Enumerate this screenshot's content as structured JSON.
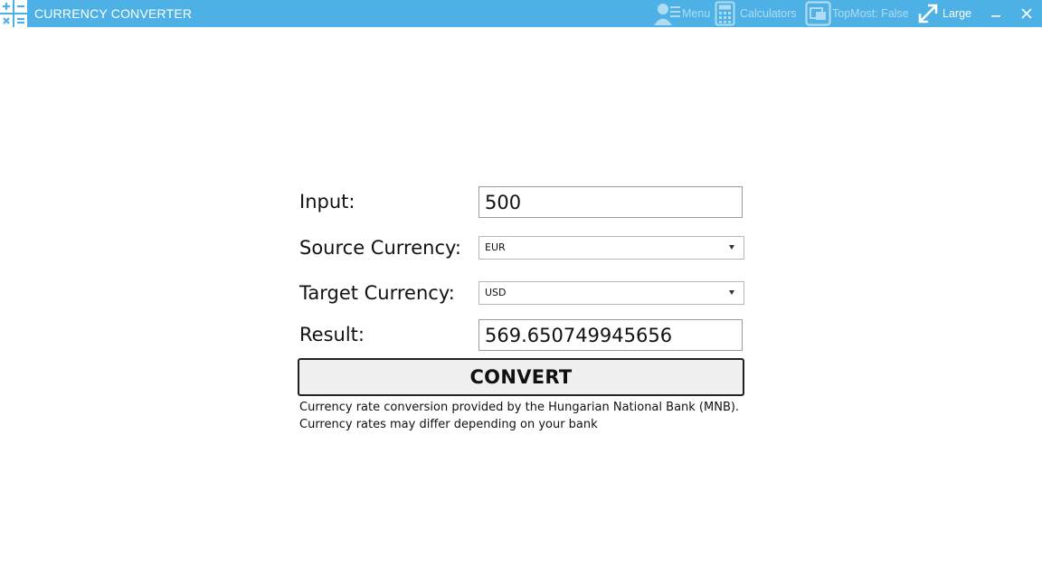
{
  "window": {
    "title": "CURRENCY CONVERTER",
    "accent_color": "#4db1e6",
    "app_icon": "calculator-operators-icon"
  },
  "toolbar": {
    "menu_label": "Menu",
    "calculators_label": "Calculators",
    "topmost_label": "TopMost: False",
    "size_label": "Large",
    "icons": [
      "user-menu-icon",
      "calculator-icon",
      "topmost-window-icon",
      "resize-arrow-icon",
      "minimize-icon",
      "close-icon"
    ]
  },
  "form": {
    "input_label": "Input:",
    "input_value": "500",
    "source_label": "Source Currency:",
    "source_value": "EUR",
    "target_label": "Target Currency:",
    "target_value": "USD",
    "result_label": "Result:",
    "result_value": "569.650749945656",
    "convert_label": "CONVERT"
  },
  "footer": {
    "note_line1": "Currency rate conversion provided by the Hungarian National Bank (MNB).",
    "note_line2": "Currency rates may differ depending on your bank"
  }
}
